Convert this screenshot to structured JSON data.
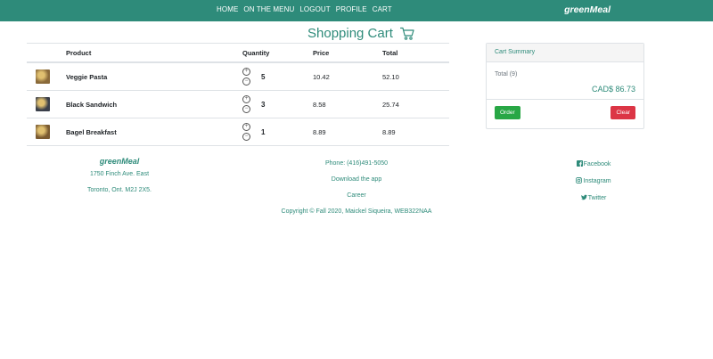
{
  "nav": {
    "links": [
      "HOME",
      "ON THE MENU",
      "LOGOUT",
      "PROFILE",
      "CART"
    ],
    "brand": "greenMeal"
  },
  "page": {
    "title": "Shopping Cart",
    "icon": "shopping-cart-icon"
  },
  "table": {
    "headers": {
      "product": "Product",
      "quantity": "Quantity",
      "price": "Price",
      "total": "Total"
    },
    "rows": [
      {
        "name": "Veggie Pasta",
        "quantity": "5",
        "price": "10.42",
        "total": "52.10",
        "thumb_color": "#8a6a3a"
      },
      {
        "name": "Black Sandwich",
        "quantity": "3",
        "price": "8.58",
        "total": "25.74",
        "thumb_color": "#3a3f4a"
      },
      {
        "name": "Bagel Breakfast",
        "quantity": "1",
        "price": "8.89",
        "total": "8.89",
        "thumb_color": "#7a5a30"
      }
    ]
  },
  "summary": {
    "title": "Cart Summary",
    "total_label": "Total (9)",
    "total_value": "CAD$ 86.73",
    "order_label": "Order",
    "clear_label": "Clear"
  },
  "footer": {
    "brand": "greenMeal",
    "address1": "1750 Finch Ave. East",
    "address2": "Toronto, Ont. M2J 2X5.",
    "phone": "Phone: (416)491-5050",
    "download": "Download the app",
    "career": "Career",
    "copyright": "Copyright © Fall 2020, Maickel Siqueira, WEB322NAA",
    "social": [
      "Facebook",
      "Instagram",
      "Twitter"
    ]
  },
  "colors": {
    "accent": "#2e8b7a",
    "order": "#28a745",
    "clear": "#dc3545"
  }
}
